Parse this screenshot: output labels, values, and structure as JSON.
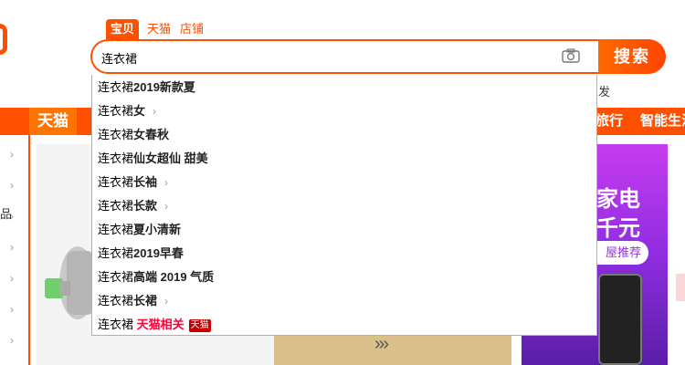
{
  "search": {
    "tabs": [
      "宝贝",
      "天猫",
      "店铺"
    ],
    "query": "连衣裙",
    "button_label": "搜索"
  },
  "hot_words": {
    "left_fragment": "‸",
    "right_fragment": "发"
  },
  "nav": {
    "tmall_label": "天猫",
    "travel_label": "旅行",
    "smart_label": "智能生活"
  },
  "side": {
    "cat_glyph": "品"
  },
  "banner": {
    "arrows": "›››"
  },
  "promo": {
    "line1": "家电",
    "line2": "千元",
    "pill": "屋推荐"
  },
  "suggestions": [
    {
      "prefix": "连衣裙",
      "suffix": "2019新款夏",
      "more": false
    },
    {
      "prefix": "连衣裙",
      "suffix": "女",
      "more": true
    },
    {
      "prefix": "连衣裙",
      "suffix": "女春秋",
      "more": false
    },
    {
      "prefix": "连衣裙",
      "suffix": "仙女超仙 甜美",
      "more": false
    },
    {
      "prefix": "连衣裙",
      "suffix": "长袖",
      "more": true
    },
    {
      "prefix": "连衣裙",
      "suffix": "长款",
      "more": true
    },
    {
      "prefix": "连衣裙",
      "suffix": "夏小清新",
      "more": false
    },
    {
      "prefix": "连衣裙",
      "suffix": "2019早春",
      "more": false
    },
    {
      "prefix": "连衣裙",
      "suffix": "高端 2019 气质",
      "more": false
    },
    {
      "prefix": "连衣裙",
      "suffix": "长裙",
      "more": true
    }
  ],
  "tmall_suggestion": {
    "prefix": "连衣裙",
    "related": "天猫相关",
    "badge": "天猫"
  },
  "colors": {
    "accent": "#ff5000",
    "tmall_red": "#ff0036"
  }
}
